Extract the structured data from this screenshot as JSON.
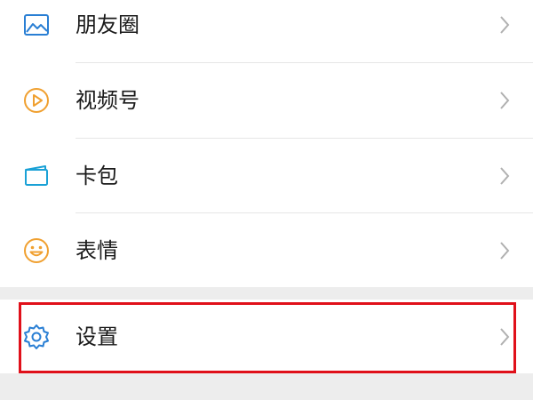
{
  "menu": {
    "items": [
      {
        "label": "朋友圈",
        "icon": "moments-icon"
      },
      {
        "label": "视频号",
        "icon": "channels-icon"
      },
      {
        "label": "卡包",
        "icon": "card-wallet-icon"
      },
      {
        "label": "表情",
        "icon": "sticker-icon"
      }
    ],
    "settings": {
      "label": "设置",
      "icon": "gear-icon"
    }
  },
  "colors": {
    "moments_icon": "#2a7fd4",
    "channels_icon": "#f0a030",
    "card_icon": "#1aa1d6",
    "sticker_icon": "#f0a030",
    "settings_icon": "#2a7fd4",
    "highlight": "#e0101a",
    "section_gap": "#ededed"
  }
}
